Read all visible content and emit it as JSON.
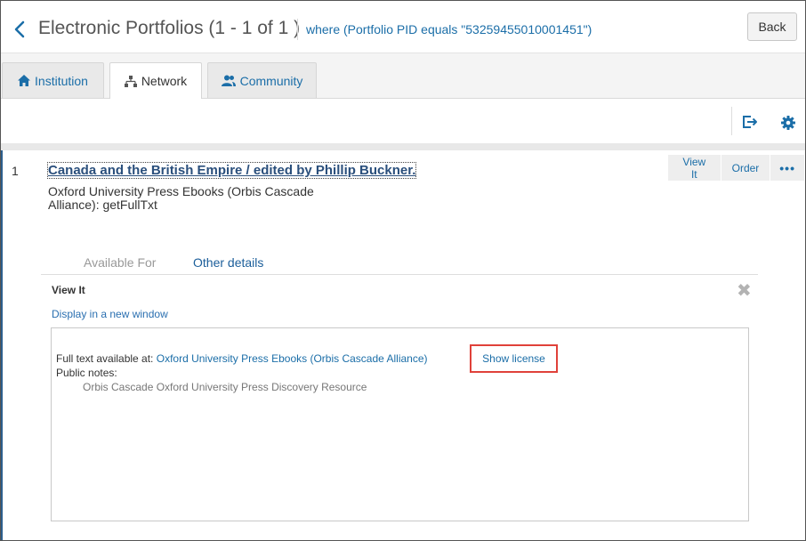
{
  "header": {
    "title": "Electronic Portfolios (1 - 1 of 1 )",
    "query": "where (Portfolio PID equals \"53259455010001451\")",
    "back_label": "Back"
  },
  "tabs": [
    {
      "label": "Institution",
      "icon": "home-icon",
      "active": false
    },
    {
      "label": "Network",
      "icon": "network-icon",
      "active": true
    },
    {
      "label": "Community",
      "icon": "users-icon",
      "active": false
    }
  ],
  "toolbar": {
    "icons": [
      "export-icon",
      "gear-icon"
    ]
  },
  "record": {
    "number": "1",
    "title": "Canada and the British Empire / edited by Phillip Buckner.",
    "subtitle": "Oxford University Press Ebooks (Orbis Cascade Alliance): getFullTxt",
    "actions": {
      "view_it": "View It",
      "order": "Order",
      "more": "•••"
    },
    "detail_tabs": [
      "Available For",
      "Other details"
    ]
  },
  "view_it": {
    "heading": "View It",
    "close": "✖",
    "display_link": "Display in a new window",
    "full_text_prefix": "Full text available at:",
    "full_text_link": "Oxford University Press Ebooks (Orbis Cascade Alliance)",
    "show_license": "Show license",
    "public_notes_label": "Public notes:",
    "public_notes_text": "Orbis Cascade Oxford University Press Discovery Resource"
  },
  "colors": {
    "link": "#1b6ea8",
    "highlight_box": "#e0413a",
    "accent_line": "#2c5e8c"
  }
}
